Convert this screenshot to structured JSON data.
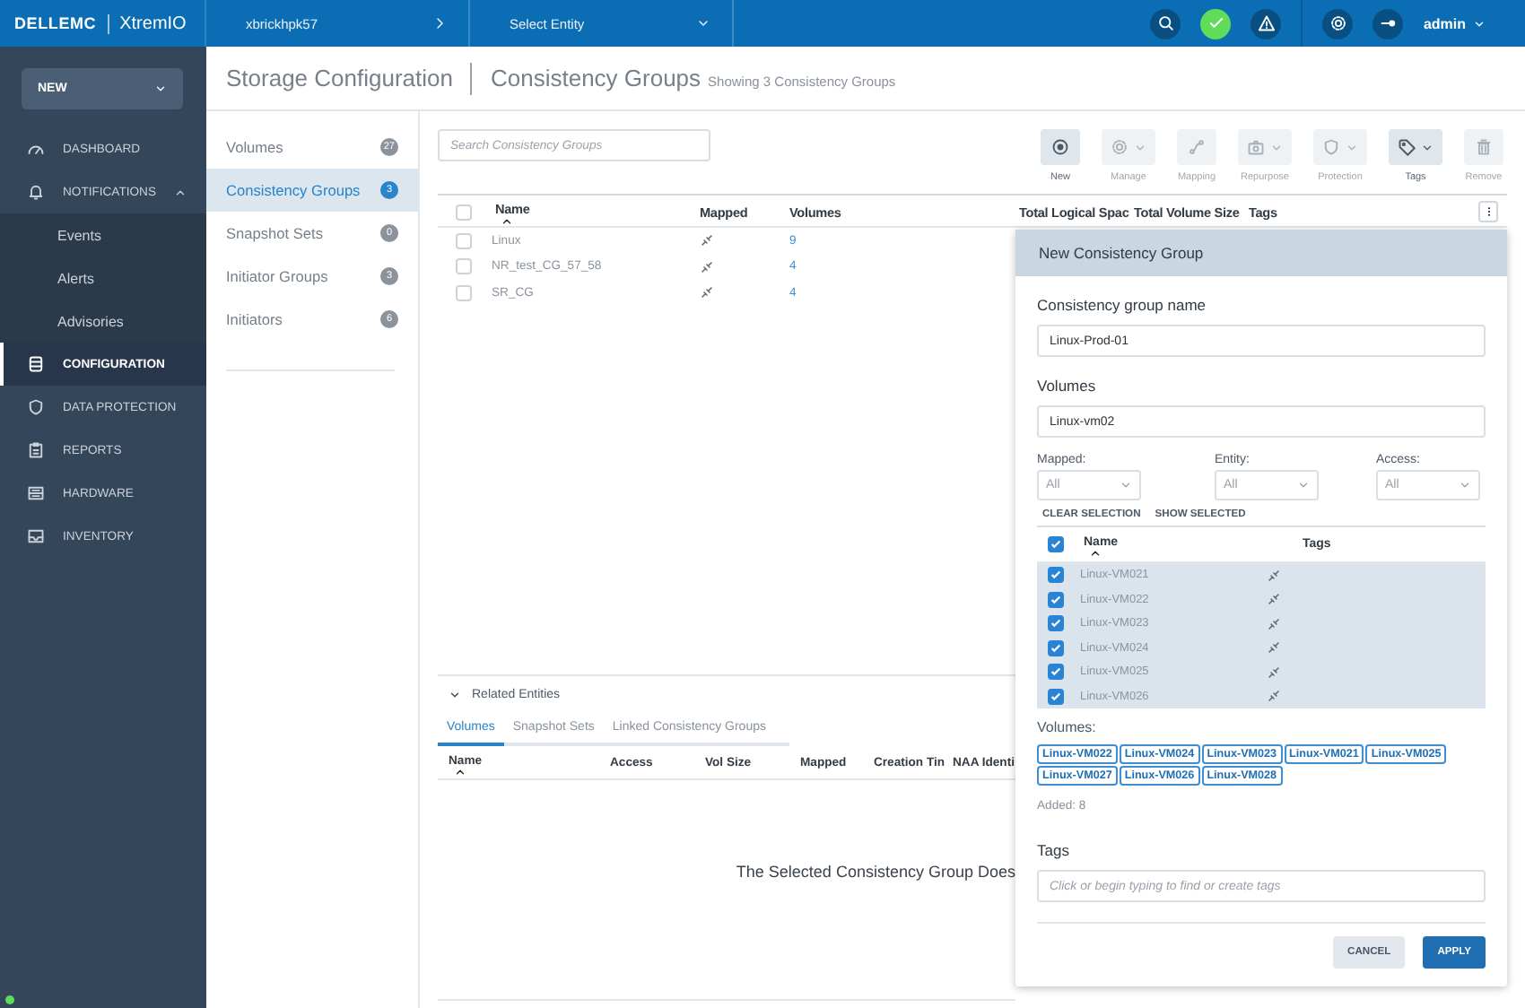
{
  "header": {
    "logo": "DELLEMC",
    "product": "XtremIO",
    "breadcrumb": [
      {
        "label": "xbrickhpk57",
        "kind": "next"
      },
      {
        "label": "Select Entity",
        "kind": "dropdown"
      }
    ],
    "user": "admin"
  },
  "sidebar": {
    "new_button": "NEW",
    "items": [
      {
        "label": "DASHBOARD",
        "selected": false
      },
      {
        "label": "NOTIFICATIONS",
        "selected": false,
        "expanded": true,
        "children": [
          {
            "label": "Events",
            "selected": false
          },
          {
            "label": "Alerts",
            "selected": false
          },
          {
            "label": "Advisories",
            "selected": false
          }
        ]
      },
      {
        "label": "CONFIGURATION",
        "selected": true
      },
      {
        "label": "DATA PROTECTION",
        "selected": false
      },
      {
        "label": "REPORTS",
        "selected": false
      },
      {
        "label": "HARDWARE",
        "selected": false
      },
      {
        "label": "INVENTORY",
        "selected": false
      }
    ]
  },
  "page": {
    "title": "Storage Configuration",
    "subtitle": "Consistency Groups",
    "summary": "Showing 3 Consistency Groups"
  },
  "subnav": {
    "items": [
      {
        "label": "Volumes",
        "count": "27",
        "selected": false
      },
      {
        "label": "Consistency Groups",
        "count": "3",
        "selected": true
      },
      {
        "label": "Snapshot Sets",
        "count": "0",
        "selected": false
      },
      {
        "label": "Initiator Groups",
        "count": "3",
        "selected": false
      },
      {
        "label": "Initiators",
        "count": "6",
        "selected": false
      }
    ]
  },
  "search": {
    "placeholder": "Search Consistency Groups"
  },
  "toolbar": [
    {
      "label": "New",
      "dropdown": false,
      "disabled": false
    },
    {
      "label": "Manage",
      "dropdown": true,
      "disabled": true
    },
    {
      "label": "Mapping",
      "dropdown": false,
      "disabled": true
    },
    {
      "label": "Repurpose",
      "dropdown": true,
      "disabled": true
    },
    {
      "label": "Protection",
      "dropdown": true,
      "disabled": true
    },
    {
      "label": "Tags",
      "dropdown": true,
      "disabled": false
    },
    {
      "label": "Remove",
      "dropdown": false,
      "disabled": true
    }
  ],
  "table": {
    "all_checked": false,
    "columns": [
      "Name",
      "Mapped",
      "Volumes",
      "Total Logical Spac",
      "Total Volume Size",
      "Tags"
    ],
    "rows": [
      {
        "checked": false,
        "name": "Linux",
        "volumes": "9"
      },
      {
        "checked": false,
        "name": "NR_test_CG_57_58",
        "volumes": "4"
      },
      {
        "checked": false,
        "name": "SR_CG",
        "volumes": "4"
      }
    ]
  },
  "related": {
    "title": "Related Entities",
    "expanded": true,
    "tabs": [
      {
        "label": "Volumes",
        "selected": true
      },
      {
        "label": "Snapshot Sets",
        "selected": false
      },
      {
        "label": "Linked Consistency Groups",
        "selected": false
      }
    ],
    "columns": [
      "Name",
      "Access",
      "Vol Size",
      "Mapped",
      "Creation Tin",
      "NAA Identi"
    ],
    "message": "The Selected Consistency Group Does"
  },
  "dialog": {
    "title": "New Consistency Group",
    "name_field": {
      "label": "Consistency group name",
      "value": "Linux-Prod-01"
    },
    "volumes_field": {
      "label": "Volumes",
      "value": "Linux-vm02"
    },
    "filters": [
      {
        "label": "Mapped:",
        "value": "All"
      },
      {
        "label": "Entity:",
        "value": "All"
      },
      {
        "label": "Access:",
        "value": "All"
      }
    ],
    "actions": [
      "CLEAR SELECTION",
      "SHOW SELECTED"
    ],
    "list": {
      "columns": [
        "Name",
        "Tags"
      ],
      "all_checked": true,
      "rows": [
        {
          "name": "Linux-VM021",
          "checked": true
        },
        {
          "name": "Linux-VM022",
          "checked": true
        },
        {
          "name": "Linux-VM023",
          "checked": true
        },
        {
          "name": "Linux-VM024",
          "checked": true
        },
        {
          "name": "Linux-VM025",
          "checked": true
        },
        {
          "name": "Linux-VM026",
          "checked": true
        }
      ]
    },
    "selected_label": "Volumes:",
    "chips": [
      "Linux-VM022",
      "Linux-VM024",
      "Linux-VM023",
      "Linux-VM021",
      "Linux-VM025",
      "Linux-VM027",
      "Linux-VM026",
      "Linux-VM028"
    ],
    "added": "Added: 8",
    "tags": {
      "label": "Tags",
      "placeholder": "Click or begin typing to find or create tags"
    },
    "buttons": [
      {
        "label": "CANCEL",
        "kind": "secondary"
      },
      {
        "label": "APPLY",
        "kind": "primary"
      }
    ]
  }
}
